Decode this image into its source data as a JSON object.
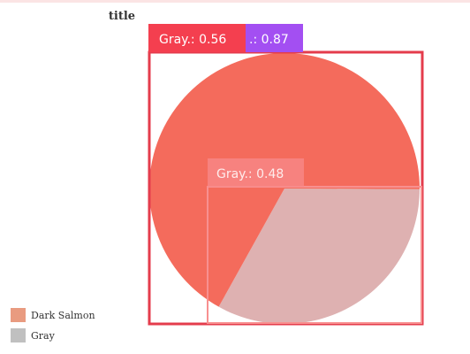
{
  "chart_data": {
    "type": "pie",
    "title": "title",
    "slices": [
      {
        "label": "Dark Salmon",
        "value": 67,
        "color": "#f46b5c"
      },
      {
        "label": "Gray",
        "value": 33,
        "color": "#deb1b1"
      }
    ],
    "legend": {
      "placement": "bottom-left",
      "entries": [
        {
          "label": "Dark Salmon",
          "color": "#e99b80"
        },
        {
          "label": "Gray",
          "color": "#c0c0c0"
        }
      ]
    },
    "detections": [
      {
        "label": "Gray.: 0.56",
        "color": "#f43f4f"
      },
      {
        "label": ".: 0.87",
        "color": "#a34ff2"
      },
      {
        "label": "Gray.: 0.48",
        "color": "#f88888"
      }
    ]
  }
}
